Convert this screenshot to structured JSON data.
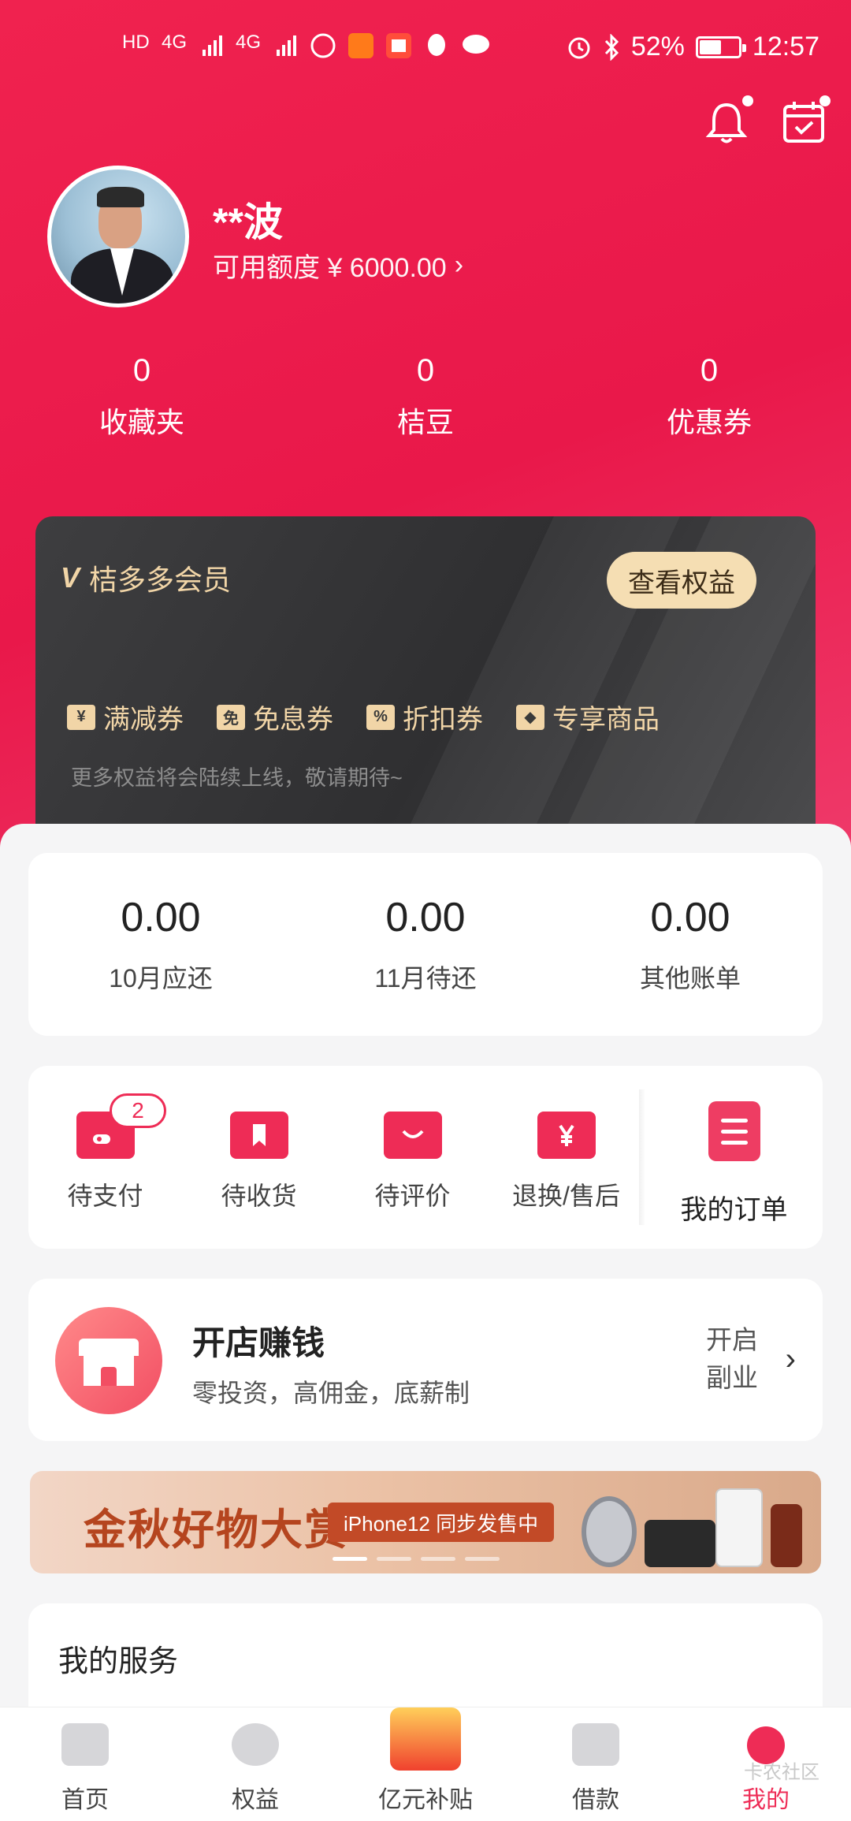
{
  "status_bar": {
    "network_labels": [
      "HD",
      "4G",
      "4G"
    ],
    "battery": "52%",
    "battery_level": 0.52,
    "time": "12:57"
  },
  "profile": {
    "name": "**波",
    "credit_label": "可用额度 ¥ 6000.00",
    "chevron": "›"
  },
  "stats": [
    {
      "value": "0",
      "label": "收藏夹"
    },
    {
      "value": "0",
      "label": "桔豆"
    },
    {
      "value": "0",
      "label": "优惠券"
    }
  ],
  "vip": {
    "logo": "V",
    "title": "桔多多会员",
    "button": "查看权益",
    "perks": [
      {
        "icon": "¥",
        "label": "满减券"
      },
      {
        "icon": "免",
        "label": "免息券"
      },
      {
        "icon": "%",
        "label": "折扣券"
      },
      {
        "icon": "◆",
        "label": "专享商品"
      }
    ],
    "note": "更多权益将会陆续上线，敬请期待~"
  },
  "bills": [
    {
      "amount": "0.00",
      "label": "10月应还"
    },
    {
      "amount": "0.00",
      "label": "11月待还"
    },
    {
      "amount": "0.00",
      "label": "其他账单"
    }
  ],
  "orders": {
    "items": [
      {
        "label": "待支付",
        "badge": "2",
        "icon": "wallet-icon"
      },
      {
        "label": "待收货",
        "icon": "package-icon"
      },
      {
        "label": "待评价",
        "icon": "comment-icon"
      },
      {
        "label": "退换/售后",
        "icon": "refund-icon"
      }
    ],
    "my_orders": "我的订单"
  },
  "shop": {
    "title": "开店赚钱",
    "subtitle": "零投资，高佣金，底薪制",
    "cta": "开启副业",
    "arrow": "›"
  },
  "banner": {
    "title": "金秋好物大赏",
    "tag": "iPhone12 同步发售中",
    "active_dot": 0
  },
  "services": {
    "title": "我的服务"
  },
  "tabbar": [
    {
      "label": "首页",
      "icon": "shopping-bag-icon"
    },
    {
      "label": "权益",
      "icon": "orange-icon"
    },
    {
      "label": "亿元补贴",
      "icon": "red-envelope-icon"
    },
    {
      "label": "借款",
      "icon": "wallet-icon"
    },
    {
      "label": "我的",
      "icon": "profile-icon",
      "active": true
    }
  ],
  "watermark": "卡农社区",
  "colors": {
    "brand": "#ee2c56",
    "vip_gold": "#f1d5a7"
  }
}
